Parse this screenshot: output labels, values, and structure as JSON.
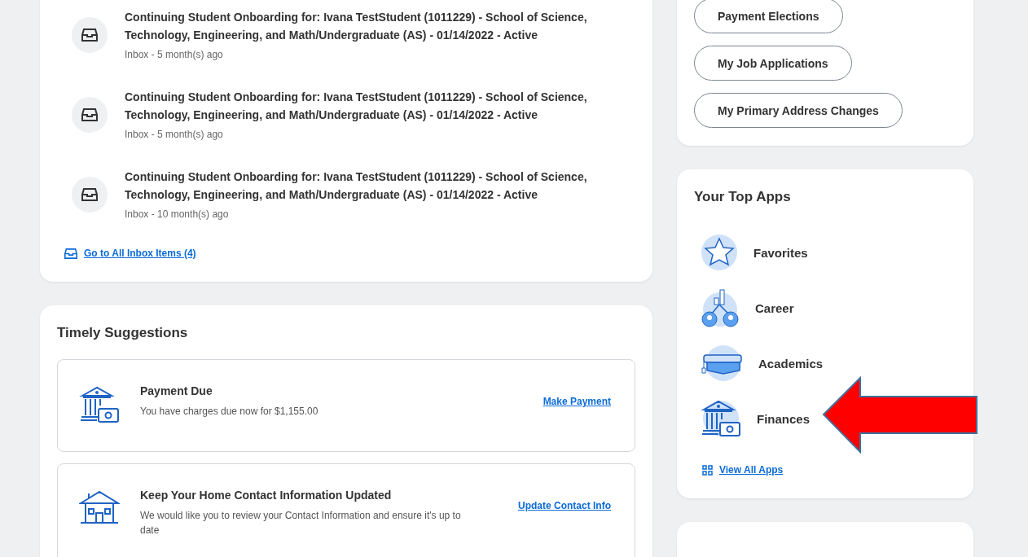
{
  "inbox": {
    "items": [
      {
        "title": "Continuing Student Onboarding for: Ivana TestStudent (1011229) - School of Science, Technology, Engineering, and Math/Undergraduate (AS) - 01/14/2022 - Active",
        "meta": "Inbox - 5 month(s) ago"
      },
      {
        "title": "Continuing Student Onboarding for: Ivana TestStudent (1011229) - School of Science, Technology, Engineering, and Math/Undergraduate (AS) - 01/14/2022 - Active",
        "meta": "Inbox - 5 month(s) ago"
      },
      {
        "title": "Continuing Student Onboarding for: Ivana TestStudent (1011229) - School of Science, Technology, Engineering, and Math/Undergraduate (AS) - 01/14/2022 - Active",
        "meta": "Inbox - 10 month(s) ago"
      }
    ],
    "link": "Go to All Inbox Items (4)"
  },
  "suggestions": {
    "title": "Timely Suggestions",
    "items": [
      {
        "kind": "payment",
        "title": "Payment Due",
        "text": "You have charges due now for $1,155.00",
        "action": "Make Payment"
      },
      {
        "kind": "home",
        "title": "Keep Your Home Contact Information Updated",
        "text": "We would like you to review your Contact Information and ensure it's up to date",
        "action": "Update Contact Info"
      }
    ]
  },
  "quick_buttons": [
    "Payment Elections",
    "My Job Applications",
    "My Primary Address Changes"
  ],
  "top_apps": {
    "title": "Your Top Apps",
    "items": [
      {
        "kind": "favorites",
        "label": "Favorites"
      },
      {
        "kind": "career",
        "label": "Career"
      },
      {
        "kind": "academics",
        "label": "Academics"
      },
      {
        "kind": "finances",
        "label": "Finances"
      }
    ],
    "link": "View All Apps"
  }
}
